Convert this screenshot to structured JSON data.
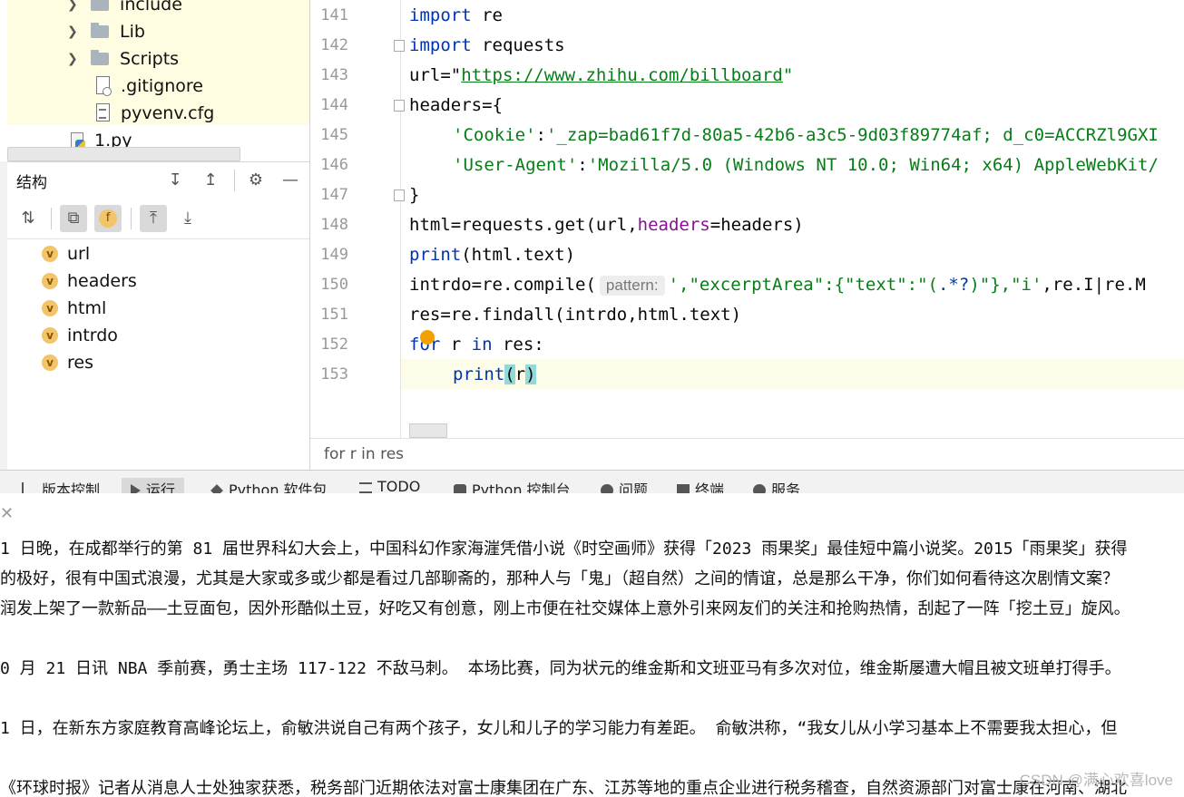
{
  "project_tree": {
    "items": [
      {
        "label": "include",
        "type": "folder"
      },
      {
        "label": "Lib",
        "type": "folder"
      },
      {
        "label": "Scripts",
        "type": "folder"
      },
      {
        "label": ".gitignore",
        "type": "file"
      },
      {
        "label": "pyvenv.cfg",
        "type": "file"
      },
      {
        "label": "1.py",
        "type": "python-file"
      }
    ]
  },
  "structure": {
    "title": "结构",
    "toolbar_icons": [
      "expand-all-icon",
      "collapse-all-icon",
      "gear-icon",
      "minimize-icon",
      "sort-alpha-icon",
      "show-inherited-icon",
      "show-fields-icon",
      "navigate-up-icon",
      "navigate-down-icon"
    ],
    "items": [
      "url",
      "headers",
      "html",
      "intrdo",
      "res"
    ],
    "item_badge": "v",
    "fields_badge": "f"
  },
  "editor": {
    "line_numbers": [
      "141",
      "142",
      "143",
      "144",
      "145",
      "146",
      "147",
      "148",
      "149",
      "150",
      "151",
      "152",
      "153"
    ],
    "code": {
      "l141_kw": "import",
      "l141_rest": " re",
      "l142_kw": "import",
      "l142_rest": " requests",
      "l143_a": "url=\"",
      "l143_link": "https://www.zhihu.com/billboard",
      "l143_b": "\"",
      "l144": "headers={",
      "l145_key": "'Cookie'",
      "l145_colon": ":",
      "l145_val": "'_zap=bad61f7d-80a5-42b6-a3c5-9d03f89774af; d_c0=ACCRZl9GXI",
      "l146_key": "'User-Agent'",
      "l146_colon": ":",
      "l146_val": "'Mozilla/5.0 (Windows NT 10.0; Win64; x64) AppleWebKit/",
      "l147": "}",
      "l148_a": "html=requests.get(url,",
      "l148_param": "headers",
      "l148_b": "=headers)",
      "l149_fn": "print",
      "l149_rest": "(html.text)",
      "l150_a": "intrdo=re.compile(",
      "l150_hint": "pattern:",
      "l150_s1": "',\"excerptArea\":",
      "l150_s2": "{\"text\":\"(",
      "l150_re": ".*?",
      "l150_s3": ")\"},\"i'",
      "l150_rest": ",re.I|re.M",
      "l151": "res=re.findall(intrdo,html.text)",
      "l152_kw1": "for",
      "l152_mid": " r ",
      "l152_kw2": "in",
      "l152_rest": " res:",
      "l153_fn": "print",
      "l153_p1": "(",
      "l153_arg": "r",
      "l153_p2": ")"
    },
    "breadcrumb": "for r in res"
  },
  "tool_tabs": [
    {
      "label": "版本控制",
      "icon": "branch-icon"
    },
    {
      "label": "运行",
      "icon": "run-icon"
    },
    {
      "label": "Python 软件包",
      "icon": "packages-icon"
    },
    {
      "label": "TODO",
      "icon": "list-icon"
    },
    {
      "label": "Python 控制台",
      "icon": "python-console-icon"
    },
    {
      "label": "问题",
      "icon": "problems-icon"
    },
    {
      "label": "终端",
      "icon": "terminal-icon"
    },
    {
      "label": "服务",
      "icon": "services-icon"
    }
  ],
  "output": {
    "lines": [
      "1 日晚，在成都举行的第 81 届世界科幻大会上，中国科幻作家海漄凭借小说《时空画师》获得「2023 雨果奖」最佳短中篇小说奖。2015「雨果奖」获得",
      "的极好，很有中国式浪漫，尤其是大家或多或少都是看过几部聊斋的，那种人与「鬼」（超自然）之间的情谊，总是那么干净，你们如何看待这次剧情文案？",
      "润发上架了一款新品——土豆面包，因外形酷似土豆，好吃又有创意，刚上市便在社交媒体上意外引来网友们的关注和抢购热情，刮起了一阵「挖土豆」旋风。",
      "",
      "0 月 21 日讯 NBA 季前赛，勇士主场 117-122 不敌马刺。 本场比赛，同为状元的维金斯和文班亚马有多次对位，维金斯屡遭大帽且被文班单打得手。",
      "",
      "1 日，在新东方家庭教育高峰论坛上，俞敏洪说自己有两个孩子，女儿和儿子的学习能力有差距。 俞敏洪称，“我女儿从小学习基本上不需要我太担心，但",
      "",
      "《环球时报》记者从消息人士处独家获悉，税务部门近期依法对富士康集团在广东、江苏等地的重点企业进行税务稽查，自然资源部门对富士康在河南、湖北"
    ]
  },
  "watermark": "CSDN @满心欢喜love"
}
